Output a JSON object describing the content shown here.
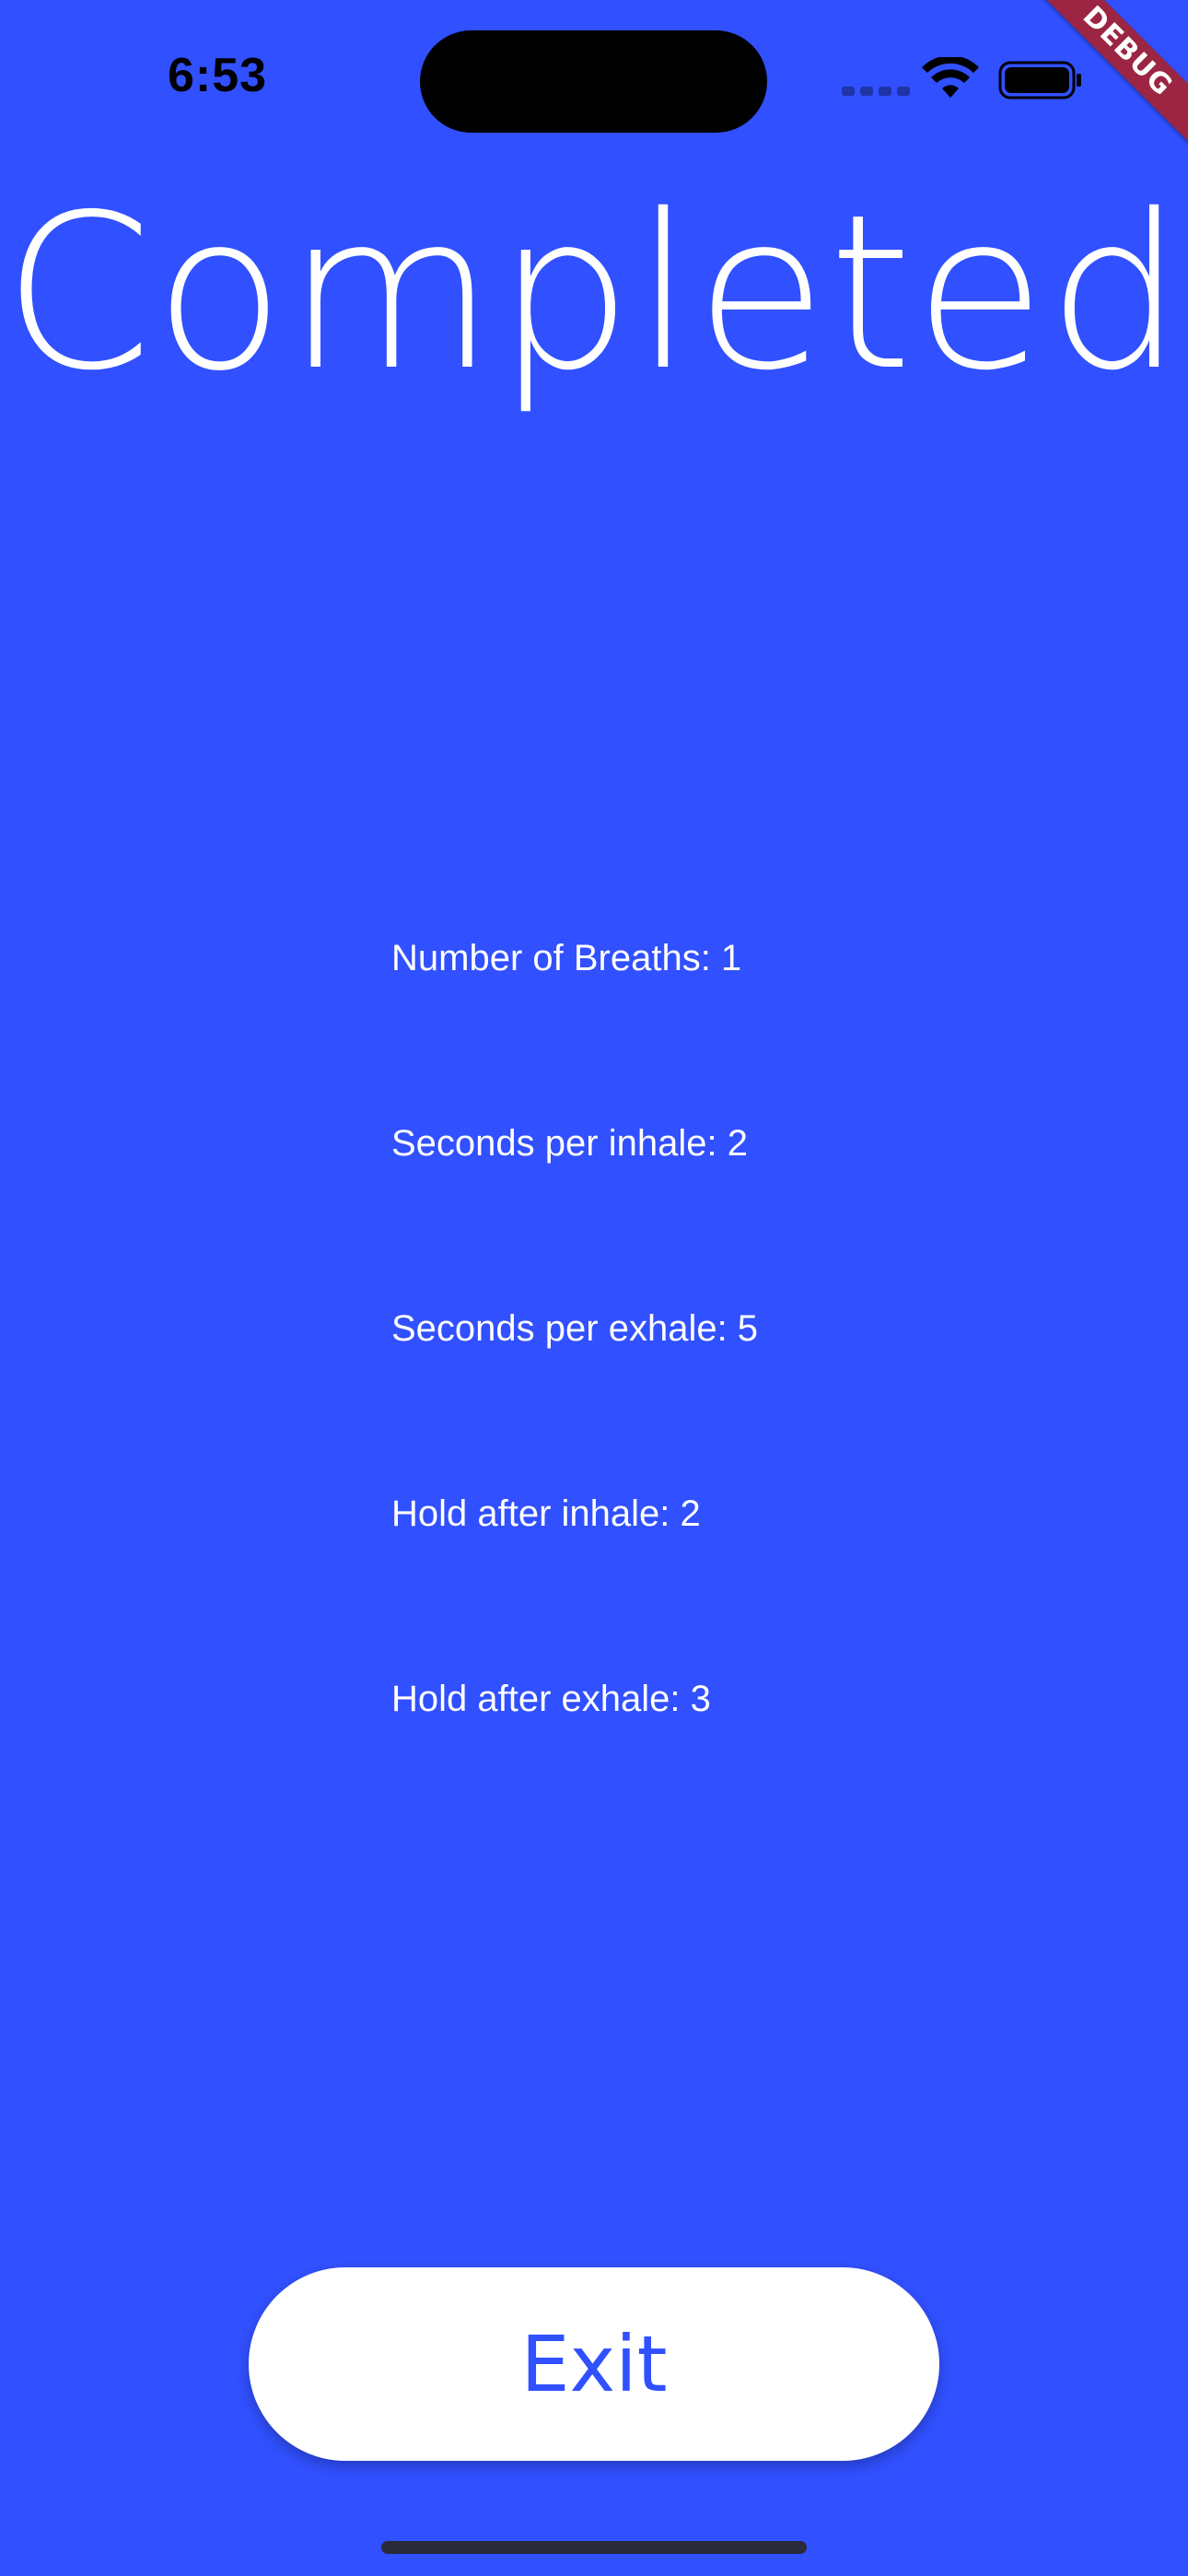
{
  "status_bar": {
    "time": "6:53"
  },
  "debug_banner": "DEBUG",
  "title": "Completed",
  "stats": [
    "Number of Breaths: 1",
    "Seconds per inhale: 2",
    "Seconds per exhale: 5",
    "Hold after inhale: 2",
    "Hold after exhale: 3"
  ],
  "exit_button_label": "Exit",
  "colors": {
    "background": "#3150FF",
    "button_background": "#FFFFFF",
    "button_text": "#3150FF",
    "debug_banner": "#9B2542"
  },
  "icons": [
    "wifi-icon",
    "battery-icon",
    "signal-icon"
  ]
}
